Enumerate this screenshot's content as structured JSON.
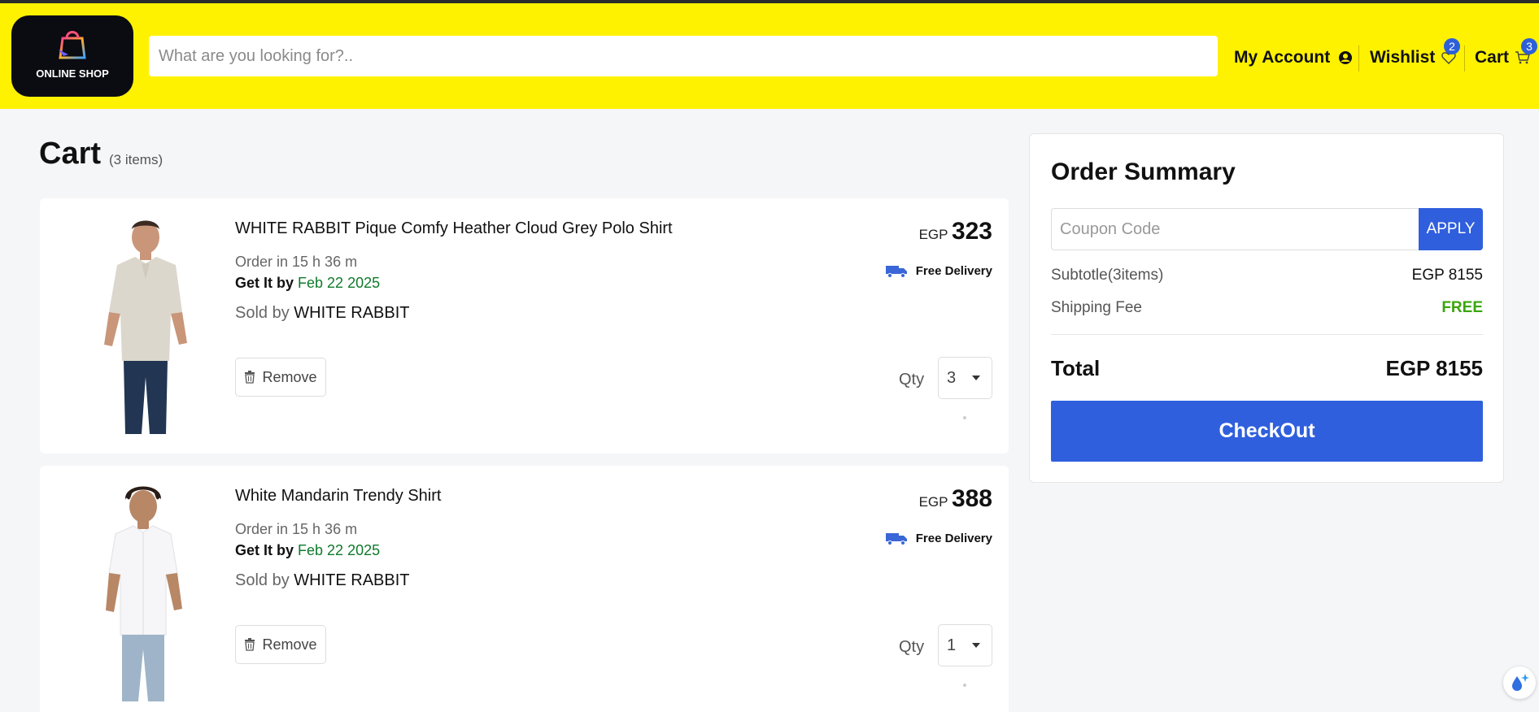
{
  "header": {
    "logo_text": "ONLINE SHOP",
    "search_placeholder": "What are you looking for?..",
    "my_account": "My Account",
    "wishlist": "Wishlist",
    "wishlist_count": "2",
    "cart": "Cart",
    "cart_count": "3"
  },
  "cart": {
    "title": "Cart",
    "count_text": "(3 items)",
    "items": [
      {
        "name": "WHITE RABBIT Pique Comfy Heather Cloud Grey Polo Shirt",
        "order_in": "Order in 15 h 36 m",
        "get_it_by": "Get It by",
        "delivery_date": "Feb 22 2025",
        "sold_by": "Sold by",
        "seller": "WHITE RABBIT",
        "remove_label": "Remove",
        "currency": "EGP",
        "price": "323",
        "delivery": "Free Delivery",
        "qty_label": "Qty",
        "qty": "3",
        "image_icon": "polo-shirt-model-image"
      },
      {
        "name": "White Mandarin Trendy Shirt",
        "order_in": "Order in 15 h 36 m",
        "get_it_by": "Get It by",
        "delivery_date": "Feb 22 2025",
        "sold_by": "Sold by",
        "seller": "WHITE RABBIT",
        "remove_label": "Remove",
        "currency": "EGP",
        "price": "388",
        "delivery": "Free Delivery",
        "qty_label": "Qty",
        "qty": "1",
        "image_icon": "white-shirt-model-image"
      }
    ]
  },
  "summary": {
    "title": "Order Summary",
    "coupon_placeholder": "Coupon Code",
    "apply_label": "APPLY",
    "subtotal_label": "Subtotle(3items)",
    "subtotal_value": "EGP 8155",
    "shipping_label": "Shipping Fee",
    "shipping_value": "FREE",
    "total_label": "Total",
    "total_value": "EGP 8155",
    "checkout_label": "CheckOut"
  },
  "colors": {
    "header_bg": "#fff200",
    "accent_blue": "#2f5fdd",
    "date_green": "#0f7a2b",
    "free_green": "#3aa60a"
  }
}
